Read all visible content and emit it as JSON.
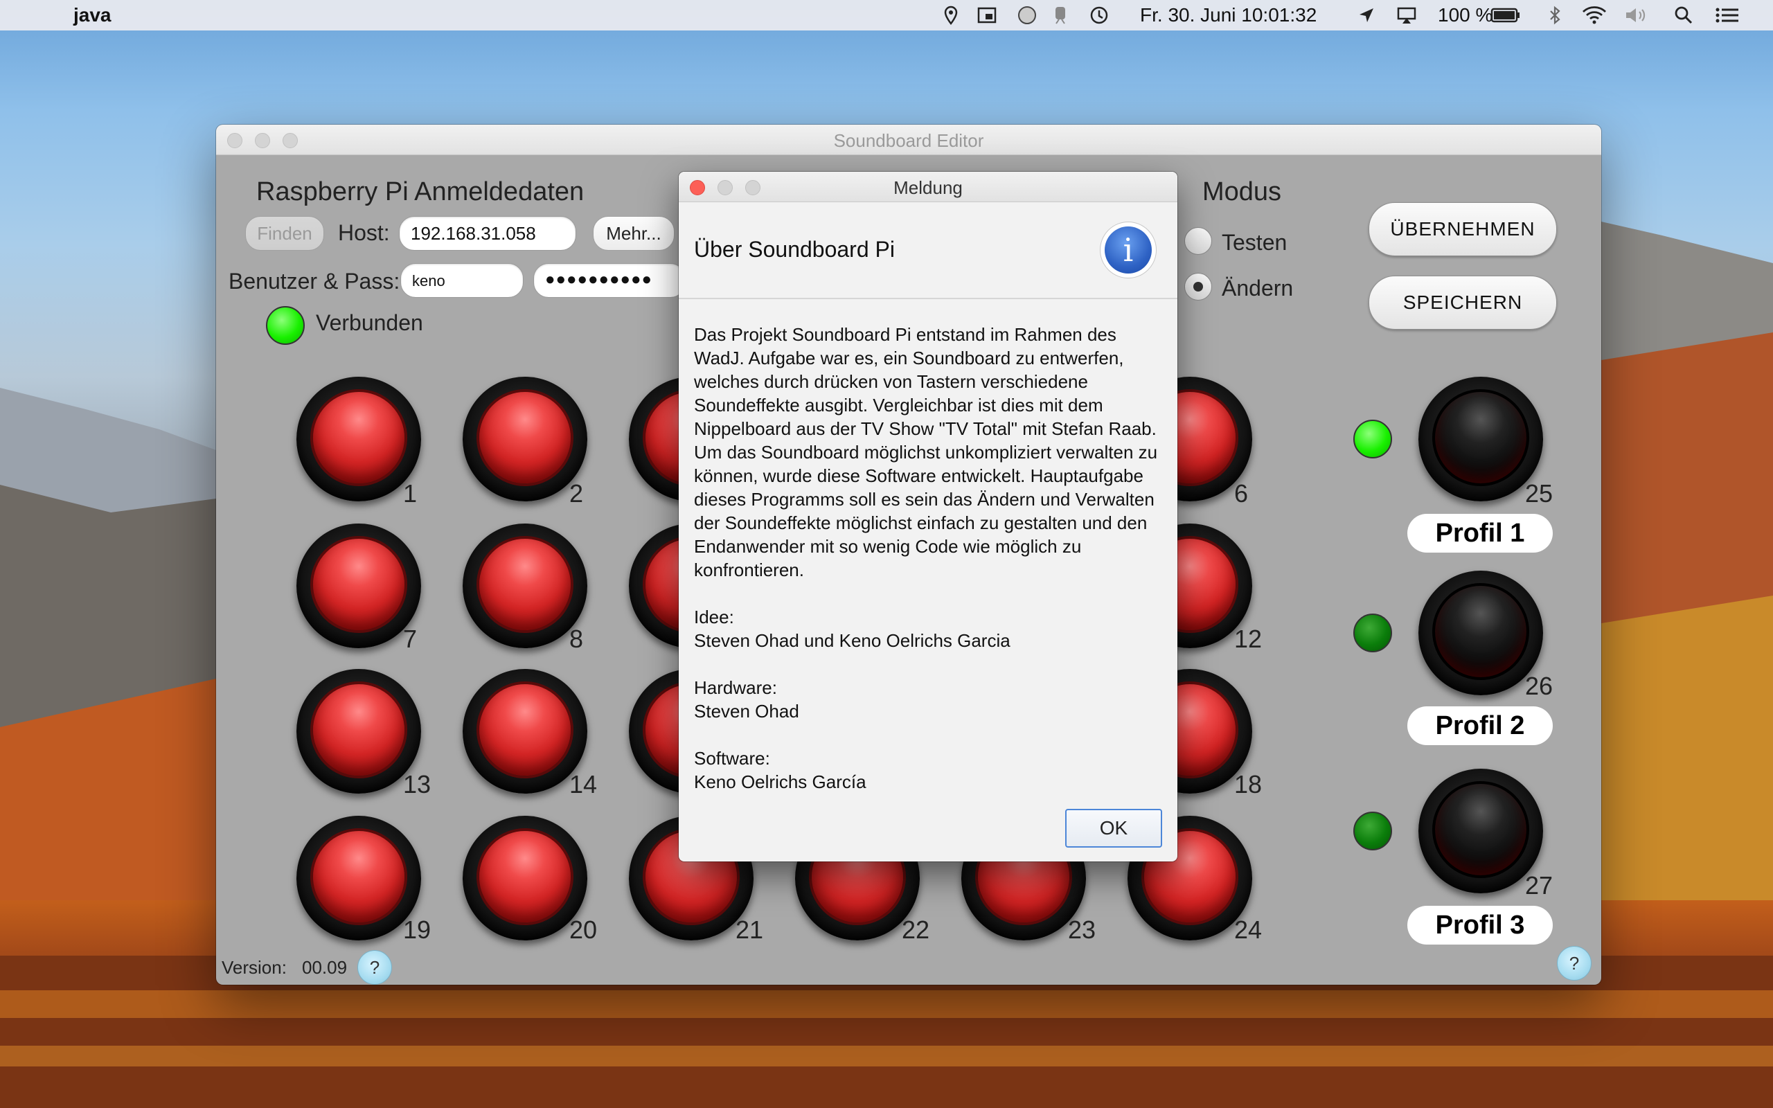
{
  "menubar": {
    "app_name": "java",
    "datetime": "Fr. 30. Juni  10:01:32",
    "battery": "100 %"
  },
  "window": {
    "title": "Soundboard Editor",
    "login_title": "Raspberry Pi Anmeldedaten",
    "find_button": "Finden",
    "host_label": "Host:",
    "host_value": "192.168.31.058",
    "more_button": "Mehr...",
    "user_pass_label": "Benutzer & Pass:",
    "user_value": "keno",
    "pass_value": "●●●●●●●●●●",
    "status_label": "Verbunden",
    "mode_title": "Modus",
    "mode_test": "Testen",
    "mode_edit": "Ändern",
    "mode_selected": "edit",
    "apply_button": "ÜBERNEHMEN",
    "save_button": "SPEICHERN",
    "version_label": "Version:",
    "version_value": "00.09",
    "help_label": "?"
  },
  "pads": {
    "n1": "1",
    "n2": "2",
    "n6": "6",
    "n7": "7",
    "n8": "8",
    "n12": "12",
    "n13": "13",
    "n14": "14",
    "n18": "18",
    "n19": "19",
    "n20": "20",
    "n21": "21",
    "n22": "22",
    "n23": "23",
    "n24": "24"
  },
  "profiles": [
    {
      "number": "25",
      "label": "Profil 1",
      "active": true
    },
    {
      "number": "26",
      "label": "Profil 2",
      "active": false
    },
    {
      "number": "27",
      "label": "Profil 3",
      "active": false
    }
  ],
  "dialog": {
    "title": "Meldung",
    "heading": "Über Soundboard Pi",
    "icon": "info-icon",
    "body": "Das Projekt Soundboard Pi entstand im Rahmen des WadJ. Aufgabe war es, ein Soundboard zu entwerfen, welches durch drücken von Tastern verschiedene Soundeffekte ausgibt. Vergleichbar ist dies mit dem Nippelboard aus der TV Show \"TV Total\" mit Stefan Raab. Um das Soundboard möglichst unkompliziert verwalten zu können, wurde diese Software entwickelt. Hauptaufgabe dieses Programms soll es sein das Ändern und Verwalten der Soundeffekte möglichst einfach zu gestalten und den Endanwender mit so wenig Code wie möglich zu konfrontieren.",
    "idea_label": "Idee:",
    "idea_value": "Steven Ohad und Keno Oelrichs Garcia",
    "hardware_label": "Hardware:",
    "hardware_value": "Steven Ohad",
    "software_label": "Software:",
    "software_value": "Keno Oelrichs García",
    "ok_button": "OK"
  },
  "colors": {
    "led_on": "#19f000",
    "led_off": "#0a7d0a",
    "pad_red": "#d32424",
    "window_bg": "#a9a9a9",
    "ok_border": "#4c86d8"
  }
}
